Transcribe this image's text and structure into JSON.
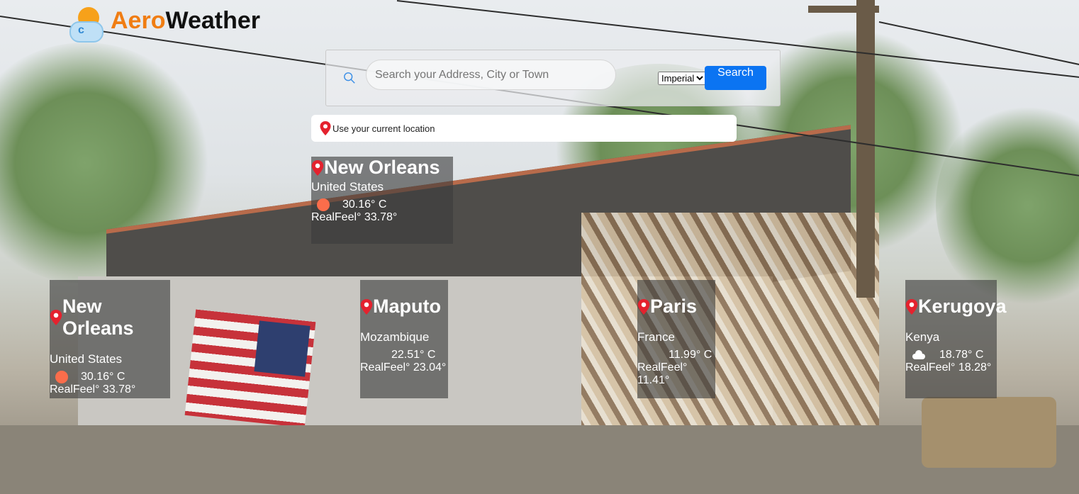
{
  "app": {
    "brand_part1": "Aero",
    "brand_part2": "Weather"
  },
  "search": {
    "placeholder": "Search your Address, City or Town",
    "unit_selected": "Imperial",
    "button_label": "Search"
  },
  "location_bar": {
    "label": "Use your current location"
  },
  "main_card": {
    "city": "New Orleans",
    "country": "United States",
    "temp": "30.16° C",
    "realfeel": "RealFeel° 33.78°",
    "icon": "sun-icon"
  },
  "cities": [
    {
      "city": "New Orleans",
      "country": "United States",
      "temp": "30.16° C",
      "realfeel": "RealFeel° 33.78°",
      "icon": "sun-icon"
    },
    {
      "city": "Maputo",
      "country": "Mozambique",
      "temp": "22.51° C",
      "realfeel": "RealFeel° 23.04°",
      "icon": "none"
    },
    {
      "city": "Paris",
      "country": "France",
      "temp": "11.99° C",
      "realfeel": "RealFeel° 11.41°",
      "icon": "none"
    },
    {
      "city": "Kerugoya",
      "country": "Kenya",
      "temp": "18.78° C",
      "realfeel": "RealFeel° 18.28°",
      "icon": "cloud-icon"
    }
  ],
  "colors": {
    "brand_orange": "#f07d13",
    "search_button": "#0b74f2",
    "pin_red": "#e4222e",
    "sun_icon": "#fb6d4b"
  }
}
